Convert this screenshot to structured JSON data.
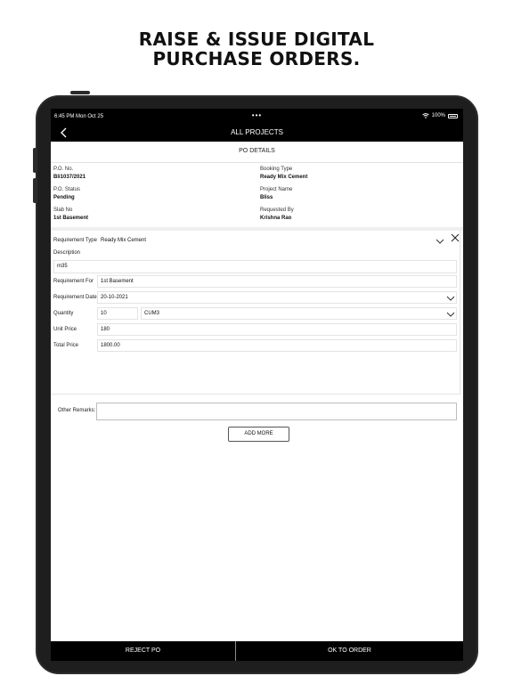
{
  "headline": {
    "line1": "RAISE & ISSUE DIGITAL",
    "line2": "PURCHASE ORDERS."
  },
  "status_bar": {
    "time": "6:45 PM  Mon Oct 25",
    "dots": "•••",
    "battery": "100%"
  },
  "nav": {
    "title": "ALL PROJECTS",
    "back_icon": "chevron-left-icon"
  },
  "section_title": "PO DETAILS",
  "po_details": {
    "po_no": {
      "label": "P.O. No.",
      "value": "Bli1037/2021"
    },
    "booking_type": {
      "label": "Booking Type",
      "value": "Ready Mix Cement"
    },
    "po_status": {
      "label": "P.O. Status",
      "value": "Pending"
    },
    "project_name": {
      "label": "Project Name",
      "value": "Bliss"
    },
    "slab_no": {
      "label": "Slab No",
      "value": "1st Basement"
    },
    "requested_by": {
      "label": "Requested By",
      "value": "Krishna Rao"
    }
  },
  "form": {
    "requirement_type": {
      "label": "Requirement Type",
      "value": "Ready Mix Cement"
    },
    "description": {
      "label": "Description",
      "value": "m35"
    },
    "requirement_for": {
      "label": "Requirement For",
      "value": "1st Basement"
    },
    "requirement_date": {
      "label": "Requirement Date",
      "value": "20-10-2021"
    },
    "quantity": {
      "label": "Quantity",
      "value": "10",
      "unit": "CUM3"
    },
    "unit_price": {
      "label": "Unit Price",
      "value": "180"
    },
    "total_price": {
      "label": "Total Price",
      "value": "1800.00"
    }
  },
  "remarks": {
    "label": "Other Remarks:",
    "value": ""
  },
  "add_more_label": "ADD MORE",
  "footer": {
    "reject_label": "REJECT PO",
    "ok_label": "OK TO ORDER"
  }
}
